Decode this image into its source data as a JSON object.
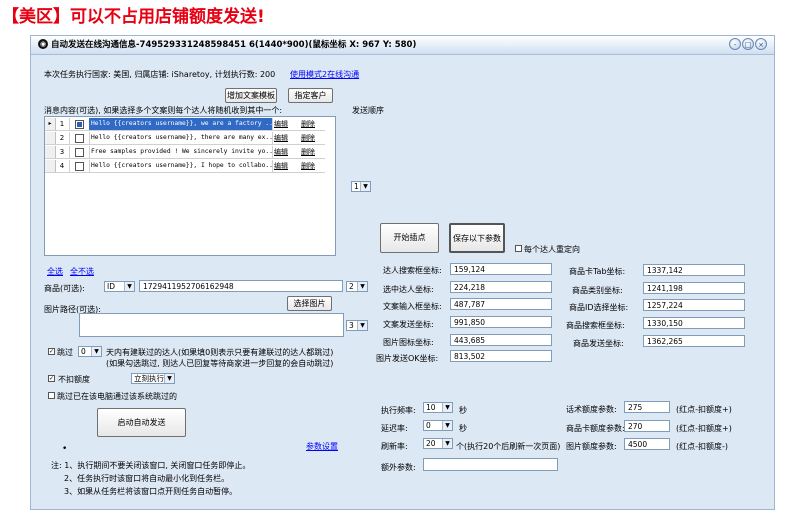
{
  "headline": "【美区】可以不占用店铺额度发送!",
  "window": {
    "title": "自动发送在线沟通信息-749529331248598451 6(1440*900)(鼠标坐标 X: 967  Y: 580)",
    "buttons": [
      "-",
      "□",
      "×"
    ]
  },
  "info": {
    "task_line": "本次任务执行国家: 美国, 归属店铺: iSharetoy, 计划执行数: 200",
    "switch_link": "使用模式2在线沟通"
  },
  "buttons": {
    "add_template": "增加文案模板",
    "assign_customer": "指定客户",
    "select_image": "选择图片",
    "start_capture": "开始插点",
    "save_params": "保存以下参数",
    "start_auto_send": "启动自动发送"
  },
  "messages": {
    "label": "消息内容(可选), 如果选择多个文案则每个达人将随机收到其中一个:",
    "order_label": "发送顺序",
    "order_value": "1",
    "rows": [
      {
        "index": "1",
        "checked": true,
        "text": "Hello {{creators username}}, we are a factory ...",
        "edit": "编辑",
        "delete": "删除",
        "selected": true
      },
      {
        "index": "2",
        "checked": false,
        "text": "Hello {{creators username}}, there are many ex...",
        "edit": "编辑",
        "delete": "删除",
        "selected": false
      },
      {
        "index": "3",
        "checked": false,
        "text": "Free samples provided ! We sincerely invite yo...",
        "edit": "编辑",
        "delete": "删除",
        "selected": false
      },
      {
        "index": "4",
        "checked": false,
        "text": "Hello {{creators username}}, I hope to collabo...",
        "edit": "编辑",
        "delete": "删除",
        "selected": false
      }
    ]
  },
  "select_all": "全选",
  "deselect_all": "全不选",
  "product": {
    "label": "商品(可选):",
    "type": "ID",
    "value": "1729411952706162948",
    "order": "2"
  },
  "image": {
    "label": "图片路径(可选):",
    "order": "3"
  },
  "skip": {
    "checked": true,
    "prefix": "跳过",
    "days": "0",
    "text": "天内有建联过的达人(如果填0则表示只要有建联过的达人都跳过)",
    "note": "(如果勾选跳过, 则达人已回复等待商家进一步回复的会自动跳过)"
  },
  "no_quota": {
    "checked": true,
    "label": "不扣额度",
    "mode": "立刻执行"
  },
  "skip_processed": {
    "checked": false,
    "label": "跳过已在该电脑通过该系统跳过的"
  },
  "reset_each": {
    "checked": false,
    "label": "每个达人重定向"
  },
  "param_link": "参数设置",
  "coords_left": [
    {
      "label": "达人搜索框坐标:",
      "value": "159,124"
    },
    {
      "label": "选中达人坐标:",
      "value": "224,218"
    },
    {
      "label": "文案输入框坐标:",
      "value": "487,787"
    },
    {
      "label": "文案发送坐标:",
      "value": "991,850"
    },
    {
      "label": "图片图标坐标:",
      "value": "443,685"
    },
    {
      "label": "图片发送OK坐标:",
      "value": "813,502"
    }
  ],
  "coords_right": [
    {
      "label": "商品卡Tab坐标:",
      "value": "1337,142"
    },
    {
      "label": "商品类别坐标:",
      "value": "1241,198"
    },
    {
      "label": "商品ID选择坐标:",
      "value": "1257,224"
    },
    {
      "label": "商品搜索框坐标:",
      "value": "1330,150"
    },
    {
      "label": "商品发送坐标:",
      "value": "1362,265"
    }
  ],
  "settings_left": [
    {
      "label": "执行频率:",
      "value": "10",
      "unit": "秒"
    },
    {
      "label": "延迟率:",
      "value": "0",
      "unit": "秒"
    },
    {
      "label": "刷新率:",
      "value": "20",
      "unit": "个(执行20个后刷新一次页面)"
    },
    {
      "label": "额外参数:",
      "value": ""
    }
  ],
  "settings_right": [
    {
      "label": "话术额度参数:",
      "value": "275",
      "note": "(红点-扣额度+)"
    },
    {
      "label": "商品卡额度参数:",
      "value": "270",
      "note": "(红点-扣额度+)"
    },
    {
      "label": "图片额度参数:",
      "value": "4500",
      "note": "(红点-扣额度-)"
    }
  ],
  "notes": [
    "注: 1、执行期间不要关闭该窗口, 关闭窗口任务即停止。",
    "2、任务执行时该窗口将自动最小化到任务栏。",
    "3、如果从任务栏将该窗口点开则任务自动暂停。"
  ]
}
